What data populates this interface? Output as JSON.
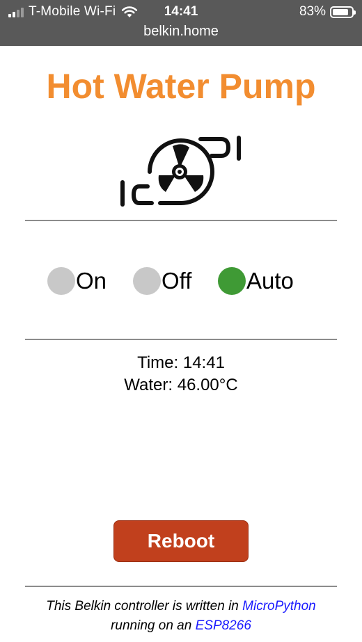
{
  "status_bar": {
    "carrier": "T-Mobile Wi-Fi",
    "time": "14:41",
    "battery": "83%",
    "battery_level": 0.83,
    "url": "belkin.home"
  },
  "page": {
    "title": "Hot Water Pump",
    "title_color": "#f28d30",
    "icon": "water-pump-icon",
    "modes": [
      {
        "label": "On",
        "active": false
      },
      {
        "label": "Off",
        "active": false
      },
      {
        "label": "Auto",
        "active": true
      }
    ],
    "active_color": "#3f9a35",
    "inactive_color": "#c8c8c8",
    "time_line": "Time: 14:41",
    "water_line": "Water: 46.00°C",
    "reboot_label": "Reboot",
    "reboot_color": "#c1401d",
    "footer": {
      "prefix": "This Belkin controller is written in ",
      "link1": "MicroPython",
      "middle": "running on an ",
      "link2": "ESP8266",
      "link_color": "#1a1aff"
    }
  }
}
